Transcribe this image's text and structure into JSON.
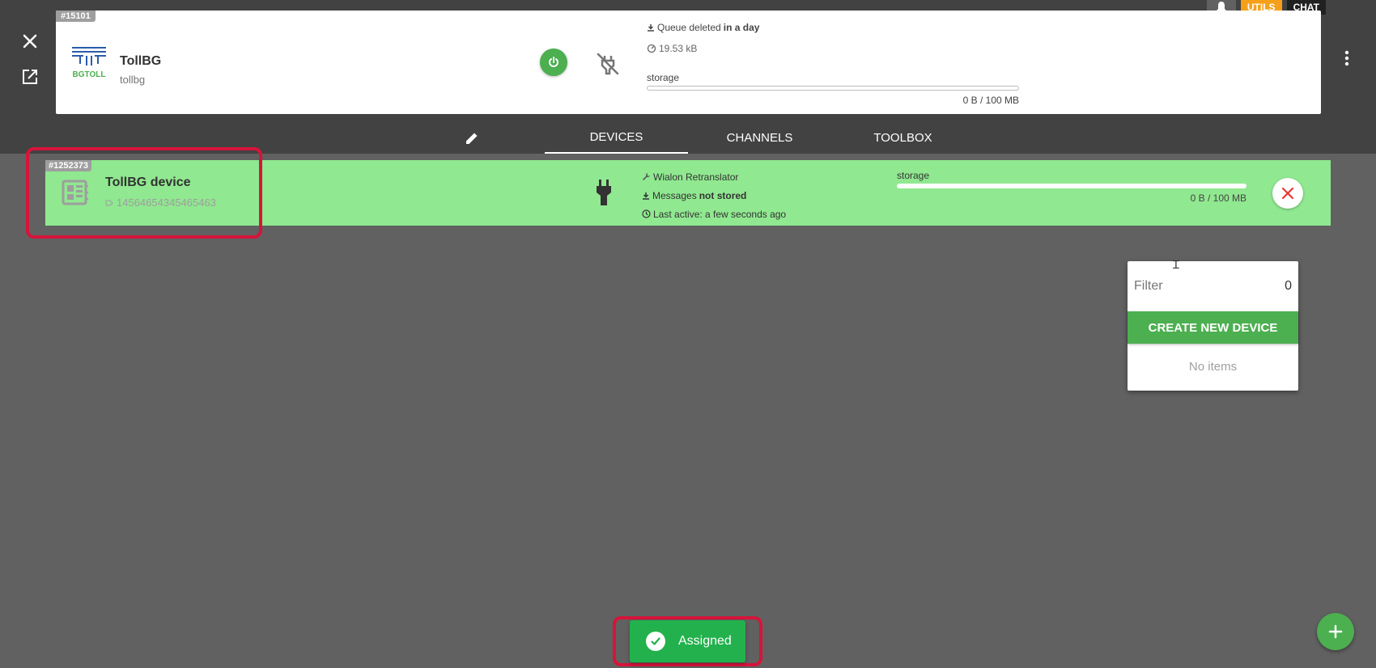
{
  "topbar": {
    "close_icon": "close-icon",
    "open_external_icon": "open-in-new-icon",
    "bell_icon": "bell-icon",
    "utils_label": "UTILS",
    "chat_label": "CHAT",
    "colors": {
      "utils": "#f6a01a",
      "chat": "#212121",
      "background": "#424242"
    }
  },
  "app": {
    "id": "#15101",
    "title": "TollBG",
    "subtitle": "tollbg",
    "logo_text": "BGTOLL",
    "queue_prefix": "Queue deleted",
    "queue_value": "in a day",
    "size": "19.53 kB",
    "storage_label": "storage",
    "storage_size": "0 B / 100 MB",
    "storage_fraction": 0
  },
  "tabs": [
    {
      "label": "DEVICES",
      "active": true
    },
    {
      "label": "CHANNELS",
      "active": false
    },
    {
      "label": "TOOLBOX",
      "active": false
    }
  ],
  "device": {
    "id": "#1252373",
    "title": "TollBG device",
    "ident": "14564654345465463",
    "protocol": "Wialon Retranslator",
    "messages_prefix": "Messages",
    "messages_value": "not stored",
    "last_active": "Last active: a few seconds ago",
    "storage_label": "storage",
    "storage_size": "0 B / 100 MB",
    "storage_fraction": 0,
    "row_color": "#90e890"
  },
  "popup": {
    "filter_placeholder": "Filter",
    "filter_count": "0",
    "create_label": "CREATE NEW DEVICE",
    "empty_label": "No items"
  },
  "toast": {
    "label": "Assigned",
    "color": "#22b14c"
  },
  "highlight_color": "#d6143a"
}
